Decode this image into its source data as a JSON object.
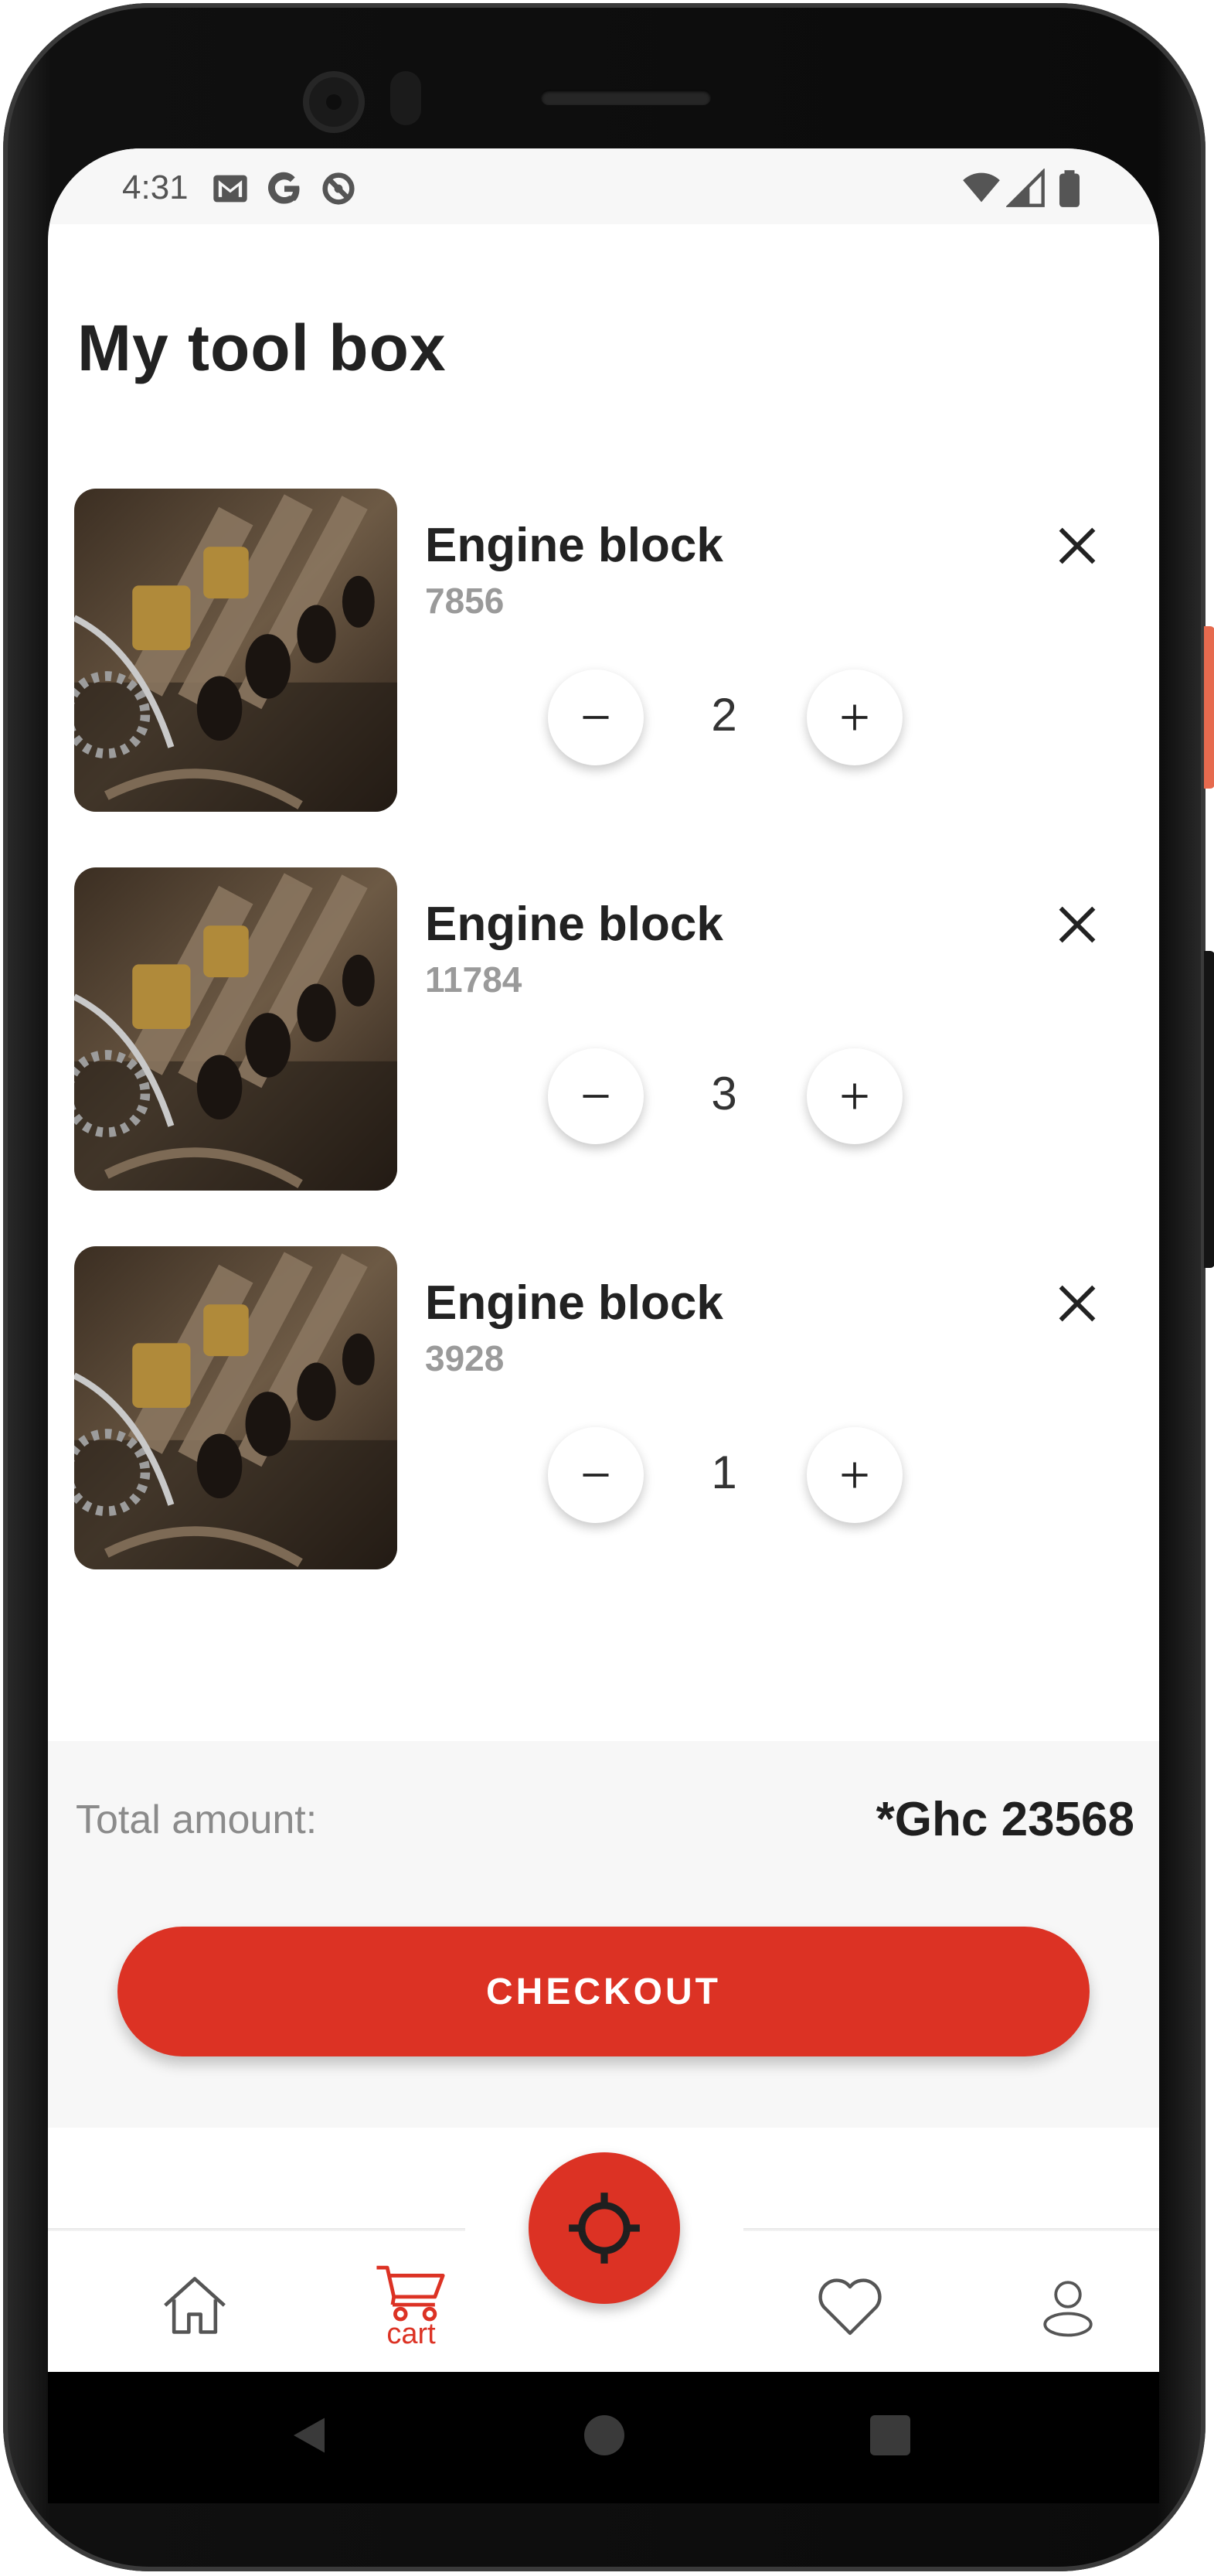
{
  "status_bar": {
    "time": "4:31",
    "left_icons": [
      "gmail-icon",
      "google-icon",
      "data-saver-icon"
    ],
    "right_icons": [
      "wifi-icon",
      "signal-icon",
      "battery-icon"
    ]
  },
  "screen": {
    "title": "My tool box"
  },
  "cart": {
    "items": [
      {
        "name": "Engine block",
        "price": "7856",
        "quantity": "2"
      },
      {
        "name": "Engine block",
        "price": "11784",
        "quantity": "3"
      },
      {
        "name": "Engine block",
        "price": "3928",
        "quantity": "1"
      }
    ],
    "decrement_symbol": "−",
    "increment_symbol": "+",
    "remove_symbol": "×"
  },
  "summary": {
    "total_label": "Total amount:",
    "total_value": "*Ghc 23568",
    "checkout_label": "CHECKOUT"
  },
  "bottom_nav": {
    "items": [
      {
        "id": "home",
        "icon": "home-icon"
      },
      {
        "id": "cart",
        "icon": "cart-icon",
        "label": "cart",
        "active": true
      },
      {
        "id": "locate",
        "icon": "crosshair-icon"
      },
      {
        "id": "favorites",
        "icon": "heart-icon"
      },
      {
        "id": "profile",
        "icon": "user-icon"
      }
    ]
  },
  "colors": {
    "accent": "#dc3224",
    "text_primary": "#222222",
    "text_secondary": "#9a9a9a",
    "summary_bg": "#f7f7f7"
  }
}
